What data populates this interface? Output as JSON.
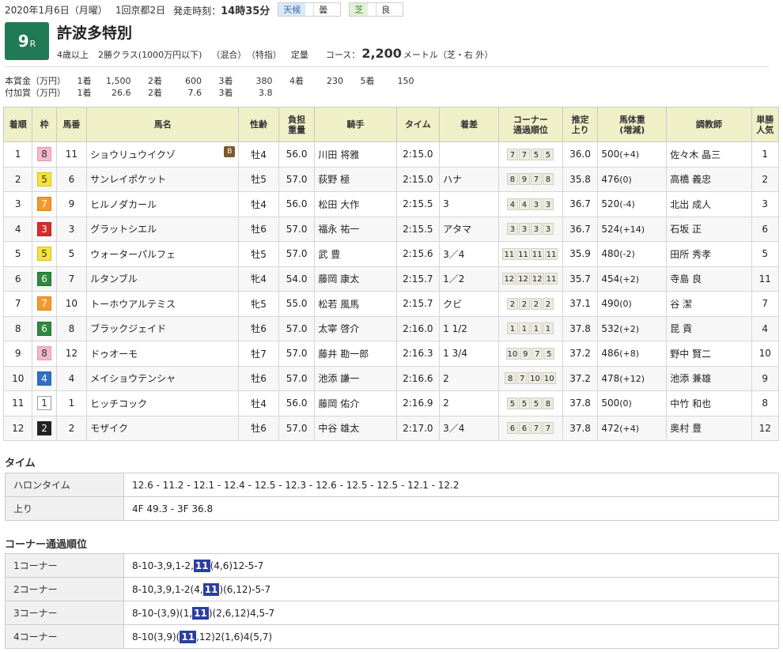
{
  "header": {
    "date": "2020年1月6日（月曜）",
    "meeting": "1回京都2日",
    "start_label": "発走時刻：",
    "start_time": "14時35分",
    "weather_label": "天候",
    "weather_value": "曇",
    "turf_label": "芝",
    "turf_value": "良",
    "race_number": "9",
    "race_suffix": "R",
    "race_name": "許波多特別",
    "conditions": [
      "4歳以上",
      "2勝クラス(1000万円以下)",
      "（混合）",
      "（特指）",
      "定量"
    ],
    "course_label": "コース：",
    "distance": "2,200",
    "distance_unit": "メートル（芝・右 外）"
  },
  "prize": {
    "main": {
      "label": "本賞金（万円）",
      "items": [
        [
          "1着",
          "1,500"
        ],
        [
          "2着",
          "600"
        ],
        [
          "3着",
          "380"
        ],
        [
          "4着",
          "230"
        ],
        [
          "5着",
          "150"
        ]
      ]
    },
    "extra": {
      "label": "付加賞（万円）",
      "items": [
        [
          "1着",
          "26.6"
        ],
        [
          "2着",
          "7.6"
        ],
        [
          "3着",
          "3.8"
        ]
      ]
    }
  },
  "results": {
    "columns": [
      "着順",
      "枠",
      "馬番",
      "馬名",
      "性齢",
      "負担\n重量",
      "騎手",
      "タイム",
      "着差",
      "コーナー\n通過順位",
      "推定\n上り",
      "馬体重\n(増減)",
      "調教師",
      "単勝\n人気"
    ],
    "rows": [
      {
        "rank": "1",
        "waku": "8",
        "num": "11",
        "horse": "ショウリュウイクゾ",
        "blinker": "B",
        "sexage": "牡4",
        "weight": "56.0",
        "jockey": "川田 将雅",
        "time": "2:15.0",
        "margin": "",
        "corners": [
          "7",
          "7",
          "5",
          "5"
        ],
        "last": "36.0",
        "bw": "500",
        "bwd": "(+4)",
        "trainer": "佐々木 晶三",
        "pop": "1"
      },
      {
        "rank": "2",
        "waku": "5",
        "num": "6",
        "horse": "サンレイポケット",
        "blinker": "",
        "sexage": "牡5",
        "weight": "57.0",
        "jockey": "荻野 極",
        "time": "2:15.0",
        "margin": "ハナ",
        "corners": [
          "8",
          "9",
          "7",
          "8"
        ],
        "last": "35.8",
        "bw": "476",
        "bwd": "(0)",
        "trainer": "高橋 義忠",
        "pop": "2"
      },
      {
        "rank": "3",
        "waku": "7",
        "num": "9",
        "horse": "ヒルノダカール",
        "blinker": "",
        "sexage": "牡4",
        "weight": "56.0",
        "jockey": "松田 大作",
        "time": "2:15.5",
        "margin": "3",
        "corners": [
          "4",
          "4",
          "3",
          "3"
        ],
        "last": "36.7",
        "bw": "520",
        "bwd": "(-4)",
        "trainer": "北出 成人",
        "pop": "3"
      },
      {
        "rank": "4",
        "waku": "3",
        "num": "3",
        "horse": "グラットシエル",
        "blinker": "",
        "sexage": "牡6",
        "weight": "57.0",
        "jockey": "福永 祐一",
        "time": "2:15.5",
        "margin": "アタマ",
        "corners": [
          "3",
          "3",
          "3",
          "3"
        ],
        "last": "36.7",
        "bw": "524",
        "bwd": "(+14)",
        "trainer": "石坂 正",
        "pop": "6"
      },
      {
        "rank": "5",
        "waku": "5",
        "num": "5",
        "horse": "ウォーターパルフェ",
        "blinker": "",
        "sexage": "牡5",
        "weight": "57.0",
        "jockey": "武 豊",
        "time": "2:15.6",
        "margin": "3／4",
        "corners": [
          "11",
          "11",
          "11",
          "11"
        ],
        "last": "35.9",
        "bw": "480",
        "bwd": "(-2)",
        "trainer": "田所 秀孝",
        "pop": "5"
      },
      {
        "rank": "6",
        "waku": "6",
        "num": "7",
        "horse": "ルタンブル",
        "blinker": "",
        "sexage": "牝4",
        "weight": "54.0",
        "jockey": "藤岡 康太",
        "time": "2:15.7",
        "margin": "1／2",
        "corners": [
          "12",
          "12",
          "12",
          "11"
        ],
        "last": "35.7",
        "bw": "454",
        "bwd": "(+2)",
        "trainer": "寺島 良",
        "pop": "11"
      },
      {
        "rank": "7",
        "waku": "7",
        "num": "10",
        "horse": "トーホウアルテミス",
        "blinker": "",
        "sexage": "牝5",
        "weight": "55.0",
        "jockey": "松若 風馬",
        "time": "2:15.7",
        "margin": "クビ",
        "corners": [
          "2",
          "2",
          "2",
          "2"
        ],
        "last": "37.1",
        "bw": "490",
        "bwd": "(0)",
        "trainer": "谷 潔",
        "pop": "7"
      },
      {
        "rank": "8",
        "waku": "6",
        "num": "8",
        "horse": "ブラックジェイド",
        "blinker": "",
        "sexage": "牡6",
        "weight": "57.0",
        "jockey": "太宰 啓介",
        "time": "2:16.0",
        "margin": "1 1/2",
        "corners": [
          "1",
          "1",
          "1",
          "1"
        ],
        "last": "37.8",
        "bw": "532",
        "bwd": "(+2)",
        "trainer": "昆 貢",
        "pop": "4"
      },
      {
        "rank": "9",
        "waku": "8",
        "num": "12",
        "horse": "ドゥオーモ",
        "blinker": "",
        "sexage": "牡7",
        "weight": "57.0",
        "jockey": "藤井 勘一郎",
        "time": "2:16.3",
        "margin": "1 3/4",
        "corners": [
          "10",
          "9",
          "7",
          "5"
        ],
        "last": "37.2",
        "bw": "486",
        "bwd": "(+8)",
        "trainer": "野中 賢二",
        "pop": "10"
      },
      {
        "rank": "10",
        "waku": "4",
        "num": "4",
        "horse": "メイショウテンシャ",
        "blinker": "",
        "sexage": "牡6",
        "weight": "57.0",
        "jockey": "池添 謙一",
        "time": "2:16.6",
        "margin": "2",
        "corners": [
          "8",
          "7",
          "10",
          "10"
        ],
        "last": "37.2",
        "bw": "478",
        "bwd": "(+12)",
        "trainer": "池添 兼雄",
        "pop": "9"
      },
      {
        "rank": "11",
        "waku": "1",
        "num": "1",
        "horse": "ヒッチコック",
        "blinker": "",
        "sexage": "牡4",
        "weight": "56.0",
        "jockey": "藤岡 佑介",
        "time": "2:16.9",
        "margin": "2",
        "corners": [
          "5",
          "5",
          "5",
          "8"
        ],
        "last": "37.8",
        "bw": "500",
        "bwd": "(0)",
        "trainer": "中竹 和也",
        "pop": "8"
      },
      {
        "rank": "12",
        "waku": "2",
        "num": "2",
        "horse": "モザイク",
        "blinker": "",
        "sexage": "牡6",
        "weight": "57.0",
        "jockey": "中谷 雄太",
        "time": "2:17.0",
        "margin": "3／4",
        "corners": [
          "6",
          "6",
          "7",
          "7"
        ],
        "last": "37.8",
        "bw": "472",
        "bwd": "(+4)",
        "trainer": "奥村 豊",
        "pop": "12"
      }
    ]
  },
  "time_section": {
    "title": "タイム",
    "rows": [
      {
        "label": "ハロンタイム",
        "value": "12.6 - 11.2 - 12.1 - 12.4 - 12.5 - 12.3 - 12.6 - 12.5 - 12.5 - 12.1 - 12.2"
      },
      {
        "label": "上り",
        "value": "4F 49.3 - 3F 36.8"
      }
    ]
  },
  "corner_section": {
    "title": "コーナー通過順位",
    "highlight": "11",
    "rows": [
      {
        "label": "1コーナー",
        "pre": "8-10-3,9,1-2,",
        "post": "(4,6)12-5-7"
      },
      {
        "label": "2コーナー",
        "pre": "8-10,3,9,1-2(4,",
        "post": ")(6,12)-5-7"
      },
      {
        "label": "3コーナー",
        "pre": "8-10-(3,9)(1,",
        "post": ")(2,6,12)4,5-7"
      },
      {
        "label": "4コーナー",
        "pre": "8-10(3,9)(",
        "post": ",12)2(1,6)4(5,7)"
      }
    ]
  }
}
